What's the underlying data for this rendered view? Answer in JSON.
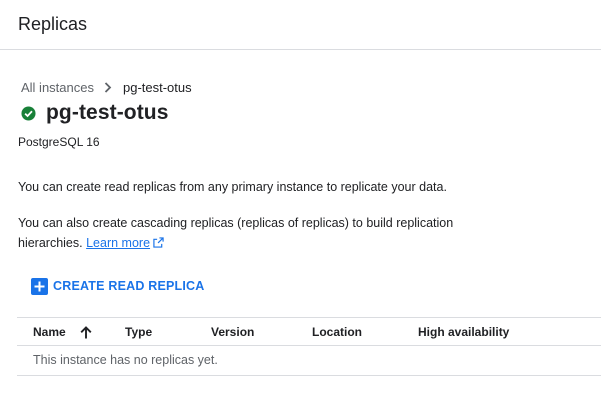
{
  "header": {
    "title": "Replicas"
  },
  "breadcrumb": {
    "parent_label": "All instances",
    "current_label": "pg-test-otus"
  },
  "instance": {
    "name": "pg-test-otus",
    "status_icon": "check-circle-icon",
    "status_color": "#188038",
    "database_version": "PostgreSQL 16"
  },
  "info": {
    "paragraph1": "You can create read replicas from any primary instance to replicate your data.",
    "paragraph2": "You can also create cascading replicas (replicas of replicas) to build replication hierarchies.",
    "learn_more_label": "Learn more"
  },
  "actions": {
    "create_read_replica_label": "CREATE READ REPLICA"
  },
  "table": {
    "columns": [
      "Name",
      "Type",
      "Version",
      "Location",
      "High availability"
    ],
    "sort_column": "Name",
    "sort_direction": "ascending",
    "empty_message": "This instance has no replicas yet."
  },
  "colors": {
    "accent": "#1a73e8",
    "text": "#202124",
    "secondary_text": "#5f6368",
    "divider": "#dadce0"
  }
}
